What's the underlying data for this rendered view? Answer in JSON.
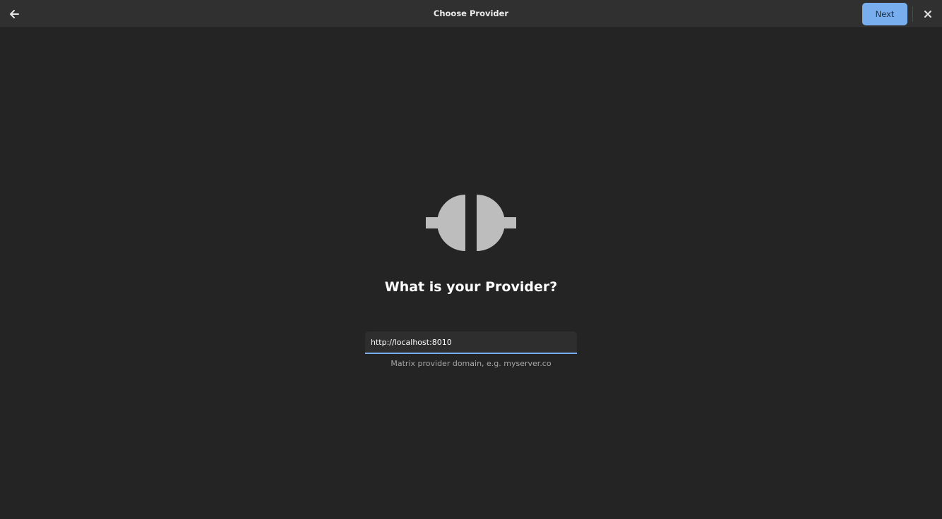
{
  "header": {
    "title": "Choose Provider",
    "next_label": "Next",
    "back_icon": "arrow-left-icon",
    "close_icon": "close-icon"
  },
  "main": {
    "icon": "provider-plug-icon",
    "heading": "What is your Provider?",
    "input": {
      "value": "http://localhost:8010",
      "placeholder": ""
    },
    "helper": "Matrix provider domain, e.g. myserver.co"
  },
  "colors": {
    "accent": "#78aeed",
    "background": "#242424",
    "headerbar": "#303030",
    "icon": "#bdbdbd"
  }
}
